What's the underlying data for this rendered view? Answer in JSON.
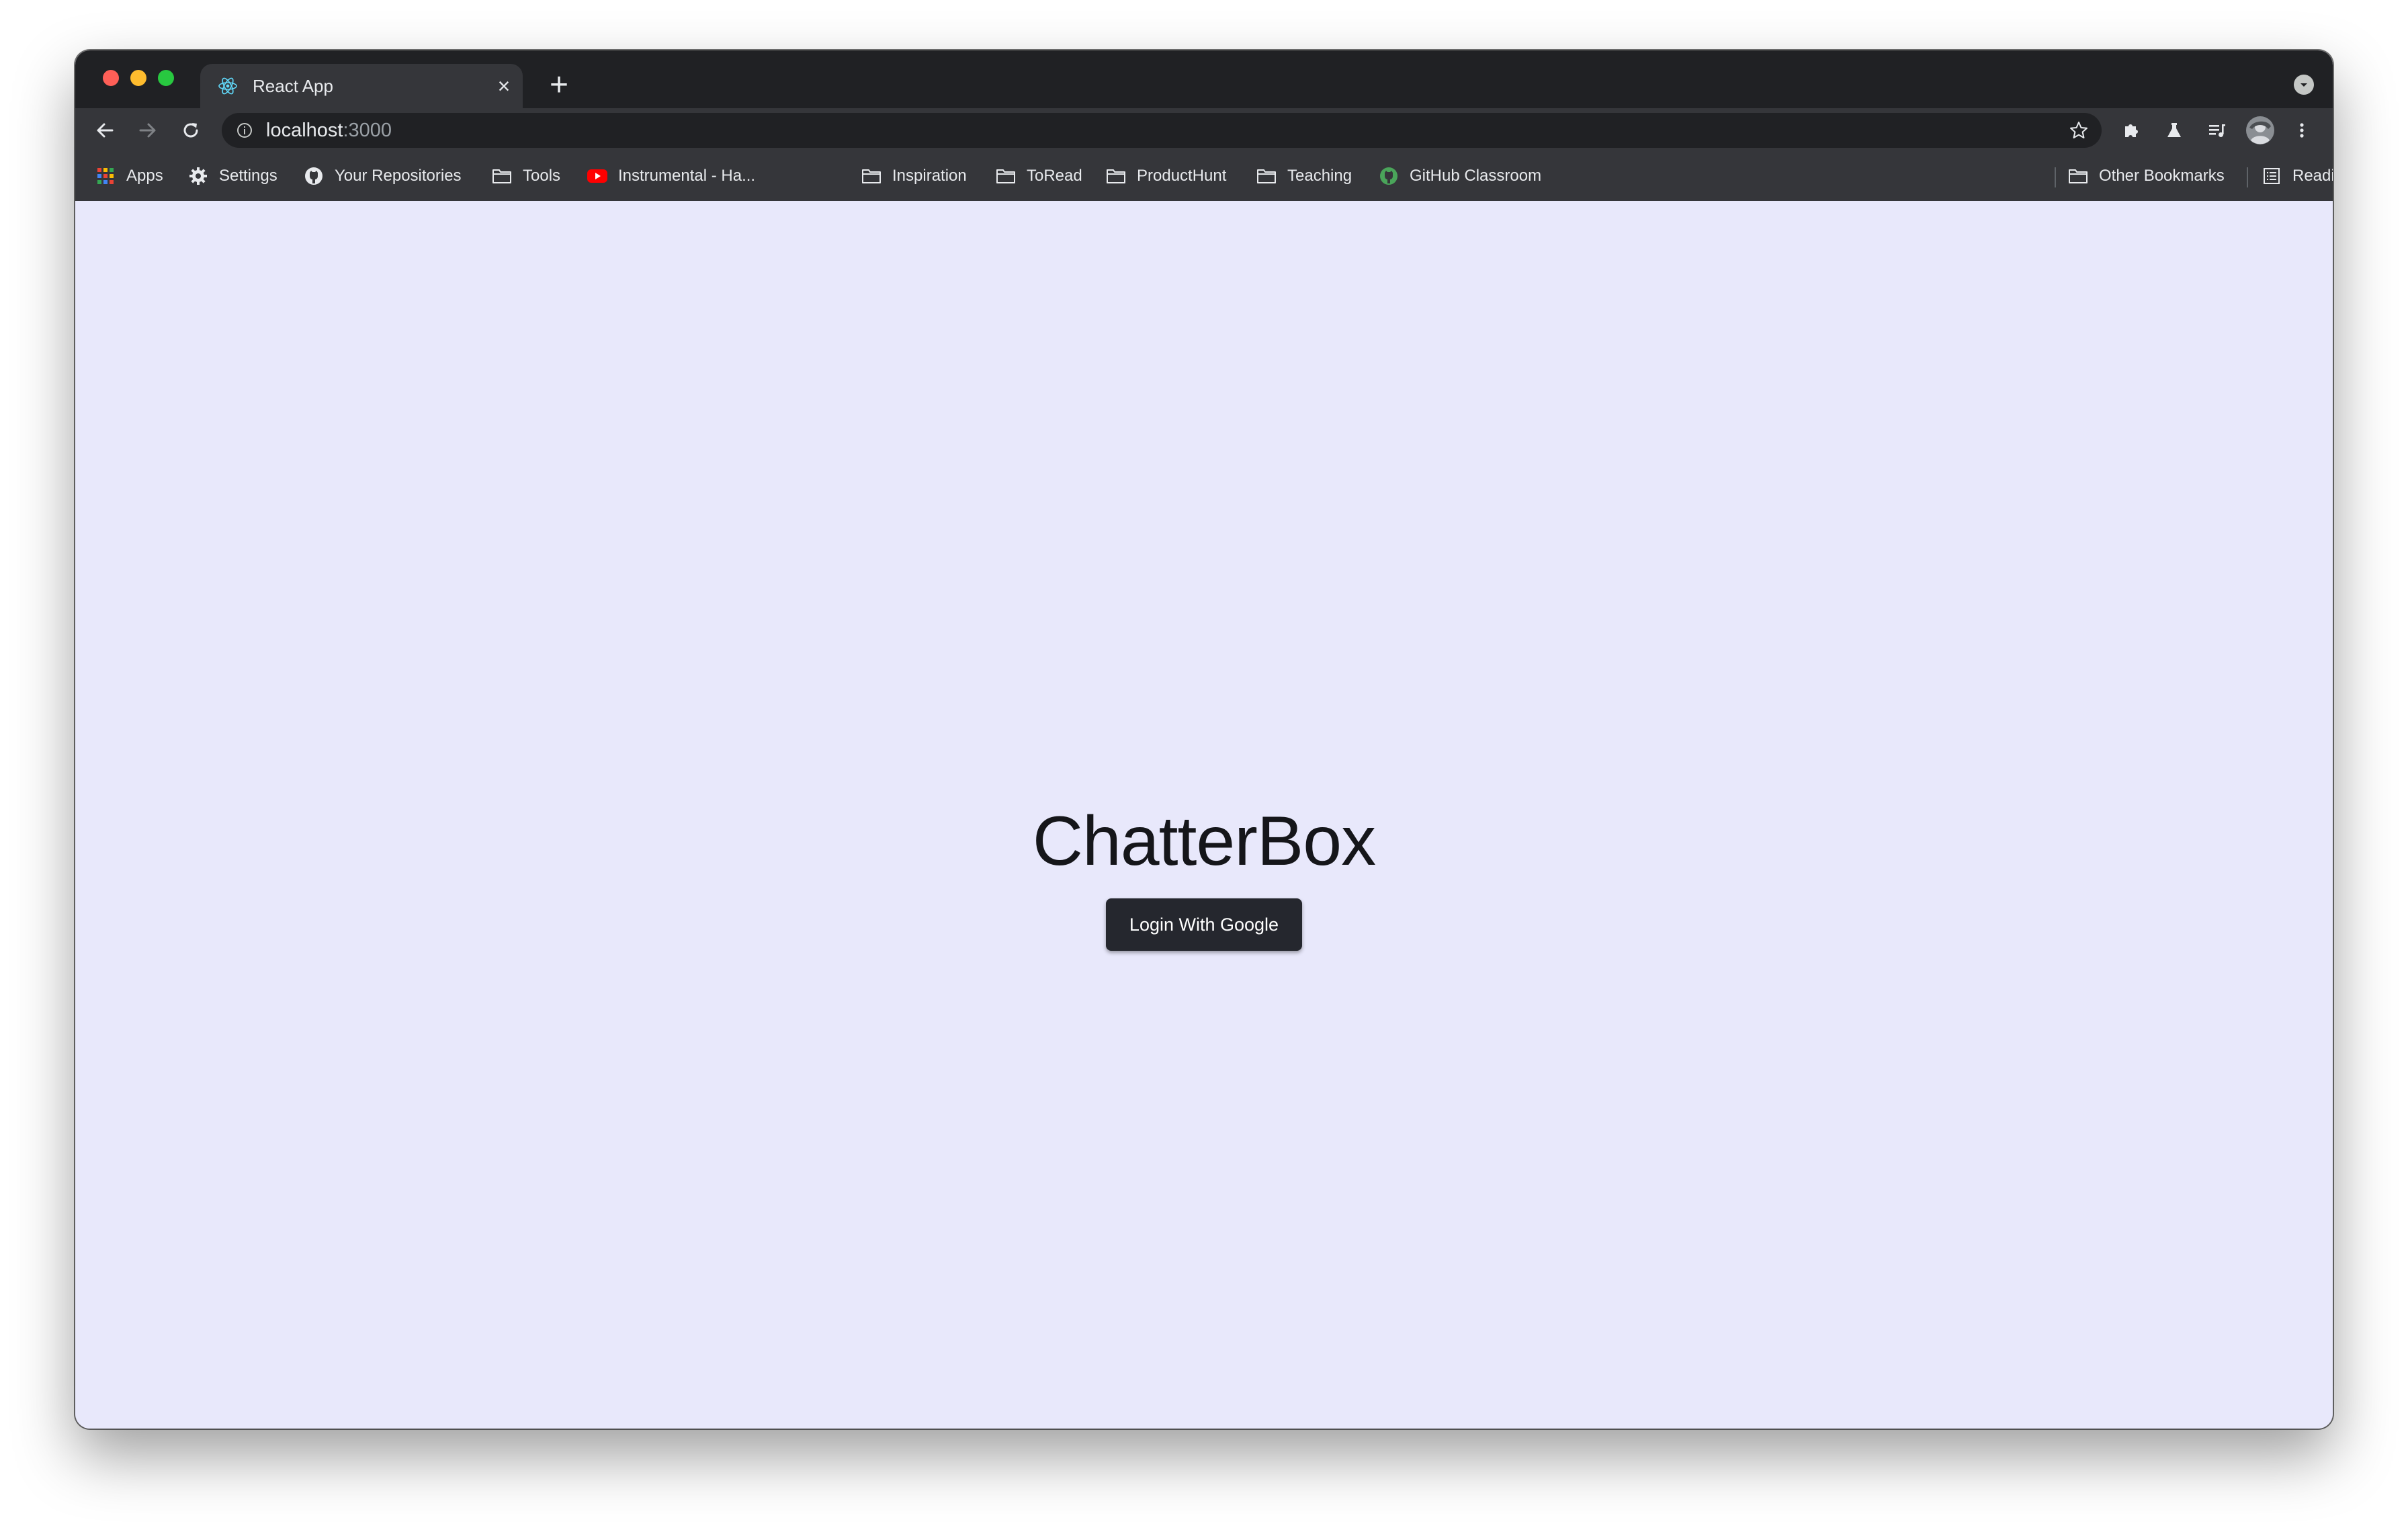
{
  "tab": {
    "title": "React App",
    "close": "×",
    "new_tab": "+"
  },
  "address": {
    "host": "localhost",
    "port": ":3000"
  },
  "bookmarks": {
    "apps": "Apps",
    "settings": "Settings",
    "repos": "Your Repositories",
    "tools": "Tools",
    "instrumental": "Instrumental - Ha...",
    "inspiration": "Inspiration",
    "toread": "ToRead",
    "producthunt": "ProductHunt",
    "teaching": "Teaching",
    "classroom": "GitHub Classroom",
    "other": "Other Bookmarks",
    "reading": "Reading List"
  },
  "app": {
    "title": "ChatterBox",
    "login_label": "Login With Google"
  },
  "colors": {
    "page_bg": "#e8e8fb",
    "button_bg": "#25272e",
    "chrome_dark": "#202124",
    "chrome_toolbar": "#35363a"
  }
}
